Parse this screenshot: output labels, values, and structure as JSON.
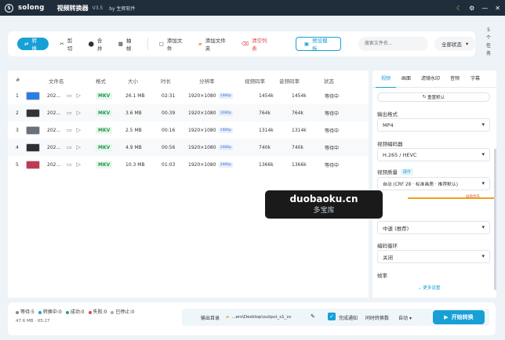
{
  "titlebar": {
    "logo": "S",
    "name": "solong",
    "title": "视频转换器",
    "version": "V3.5",
    "by": "by 生辉软件",
    "icons": [
      "moon-icon",
      "settings-icon",
      "minimize-icon",
      "close-icon"
    ]
  },
  "toolbar": {
    "convert": "转换",
    "cut": "剪切",
    "merge": "合并",
    "extract": "抽帧",
    "add_file": "添加文件",
    "add_folder": "添加文件夹",
    "clear": "清空列表",
    "preset": "预设模板",
    "search_placeholder": "搜索文件名...",
    "status_filter": "全部状态"
  },
  "side_toggle": [
    "5",
    "个",
    "任",
    "务"
  ],
  "table": {
    "headers": [
      "#",
      "文件名",
      "格式",
      "大小",
      "时长",
      "分辨率",
      "视频码率",
      "音频码率",
      "状态"
    ],
    "rows": [
      {
        "index": "1",
        "name": "202...",
        "format": "MKV",
        "size": "26.1 MB",
        "duration": "02:31",
        "resolution": "1920×1080",
        "badge": "1080p",
        "vbitrate": "1454k",
        "abitrate": "1454k",
        "status": "等待中",
        "thumb": "#2a7de1"
      },
      {
        "index": "2",
        "name": "202...",
        "format": "MKV",
        "size": "3.6 MB",
        "duration": "00:39",
        "resolution": "1920×1080",
        "badge": "1080p",
        "vbitrate": "764k",
        "abitrate": "764k",
        "status": "等待中",
        "thumb": "#333333"
      },
      {
        "index": "3",
        "name": "202...",
        "format": "MKV",
        "size": "2.5 MB",
        "duration": "00:16",
        "resolution": "1920×1080",
        "badge": "1080p",
        "vbitrate": "1314k",
        "abitrate": "1314k",
        "status": "等待中",
        "thumb": "#6a7078"
      },
      {
        "index": "4",
        "name": "202...",
        "format": "MKV",
        "size": "4.9 MB",
        "duration": "00:56",
        "resolution": "1920×1080",
        "badge": "1080p",
        "vbitrate": "740k",
        "abitrate": "740k",
        "status": "等待中",
        "thumb": "#2d2f33"
      },
      {
        "index": "5",
        "name": "202...",
        "format": "MKV",
        "size": "10.3 MB",
        "duration": "01:03",
        "resolution": "1920×1080",
        "badge": "1080p",
        "vbitrate": "1366k",
        "abitrate": "1366k",
        "status": "等待中",
        "thumb": "#c23a4e"
      }
    ]
  },
  "panel": {
    "tabs": [
      "视频",
      "画面",
      "滤镜水印",
      "音频",
      "字幕"
    ],
    "reset": "重置默认",
    "output_format_label": "输出格式",
    "output_format": "MP4",
    "encoder_label": "视频编码器",
    "encoder": "H.265 / HEVC",
    "quality_label": "视频质量",
    "hw": "硬件",
    "quality": "自动 (CRF 28 · 标准画质 · 推荐默认)",
    "slider_label": "画质优先",
    "speed_value": "中速 (推荐)",
    "loop_label": "编码循环",
    "loop_value": "关闭",
    "fps_label": "帧率",
    "more": "更多设置"
  },
  "bottom": {
    "stats": [
      {
        "label": "等待:5",
        "color": "#888888"
      },
      {
        "label": "转换中:0",
        "color": "#17a0d6"
      },
      {
        "label": "成功:0",
        "color": "#2aa55a"
      },
      {
        "label": "失败:0",
        "color": "#e0464b"
      },
      {
        "label": "已停止:0",
        "color": "#aaaaaa"
      }
    ],
    "meta": "47.6 MB · 05:27",
    "output_label": "输出目录",
    "output_path": "...ers\\Desktop\\output_s1_vc",
    "done_label": "完成通知",
    "schedule": "同时转换数",
    "count": "自动",
    "start": "开始转换"
  },
  "watermark": {
    "domain": "duobaoku.cn",
    "name": "多宝库"
  }
}
